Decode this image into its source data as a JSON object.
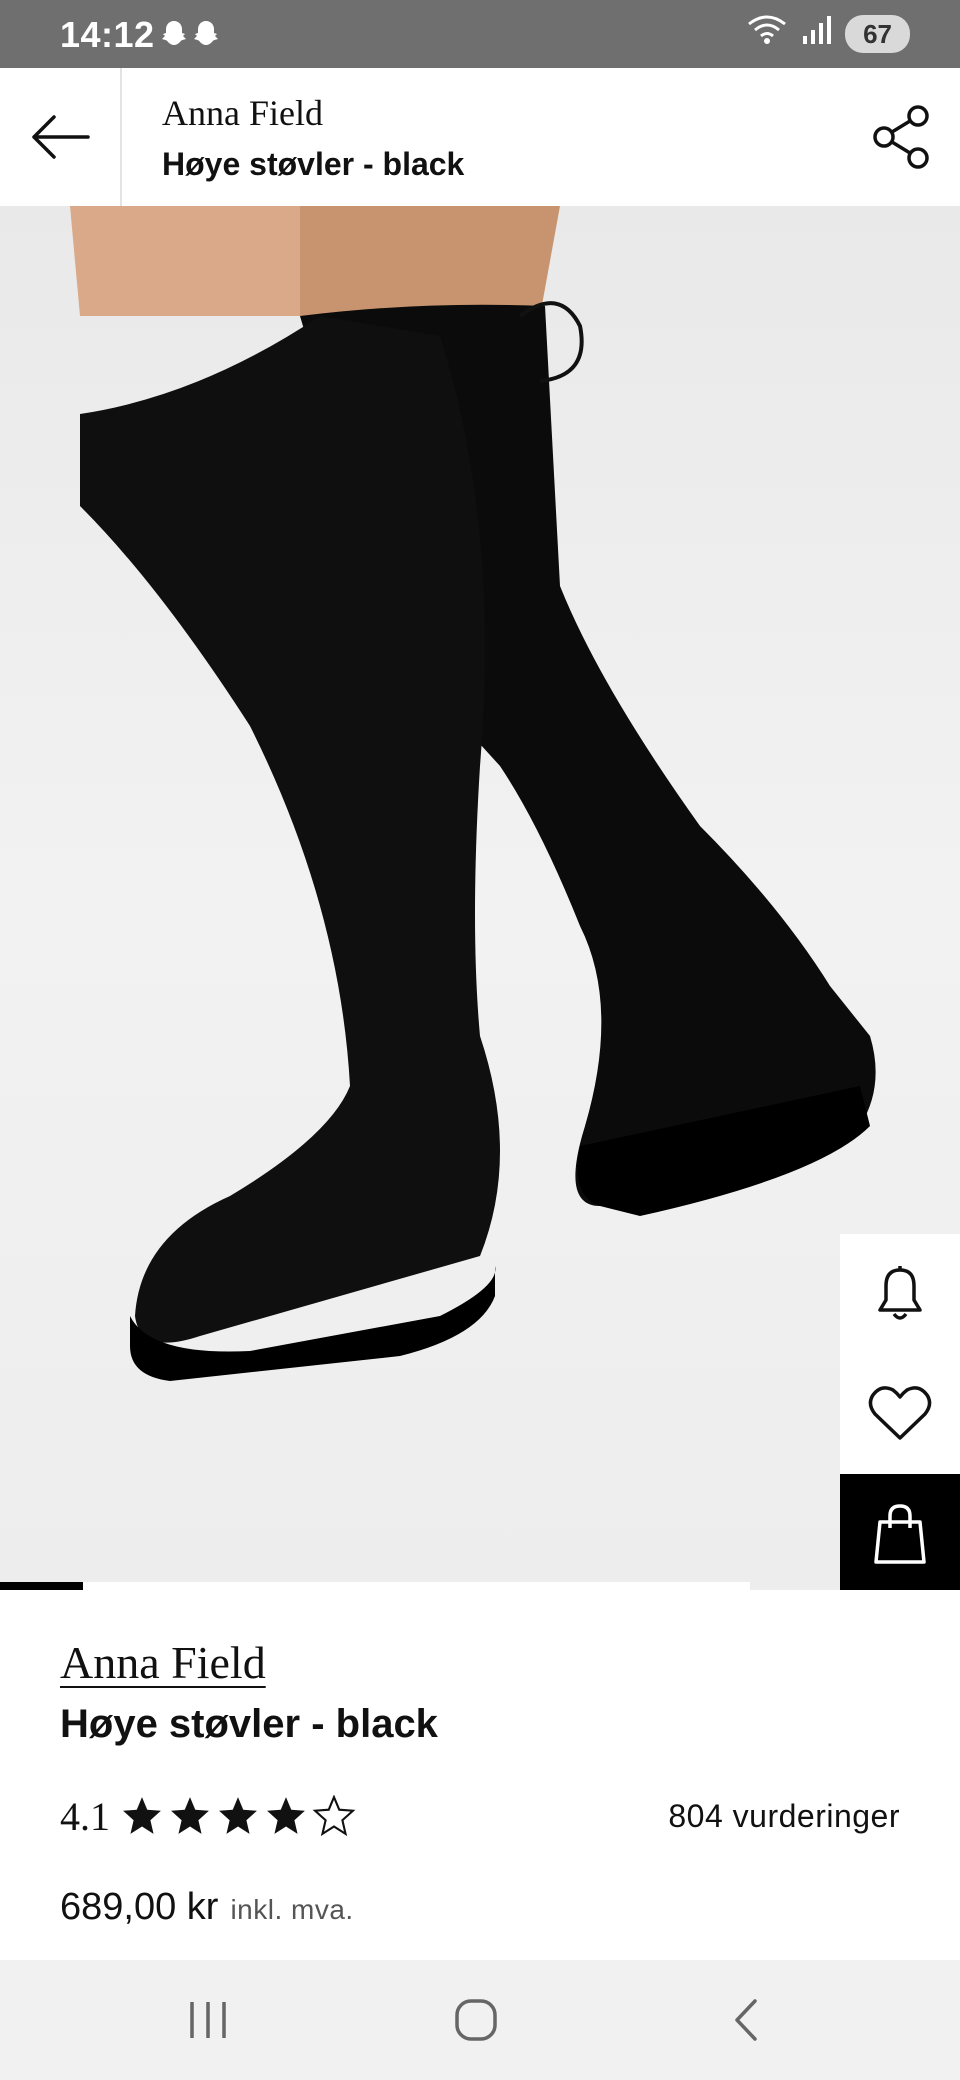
{
  "status_bar": {
    "time": "14:12",
    "notification_icons": [
      "snapchat-icon",
      "snapchat-icon"
    ],
    "wifi_label": "5",
    "battery": "67"
  },
  "header": {
    "brand": "Anna Field",
    "title": "Høye støvler - black",
    "back_icon": "arrow-left-icon",
    "share_icon": "share-icon"
  },
  "gallery": {
    "image_description": "black over-the-knee boots",
    "progress": 0.11
  },
  "side_actions": [
    {
      "name": "notify",
      "icon": "bell-icon"
    },
    {
      "name": "wishlist",
      "icon": "heart-icon"
    },
    {
      "name": "cart",
      "icon": "shopping-bag-icon"
    }
  ],
  "product": {
    "brand": "Anna Field",
    "title": "Høye støvler - black",
    "rating": "4.1",
    "stars_filled": 4,
    "stars_total": 5,
    "reviews": "804 vurderinger",
    "price": "689,00 kr",
    "vat_note": "inkl. mva."
  },
  "navbar": {
    "items": [
      "recents-icon",
      "home-icon",
      "back-icon"
    ]
  },
  "colors": {
    "status_bar": "#6f6f6f",
    "accent": "#000000",
    "background": "#ffffff"
  }
}
